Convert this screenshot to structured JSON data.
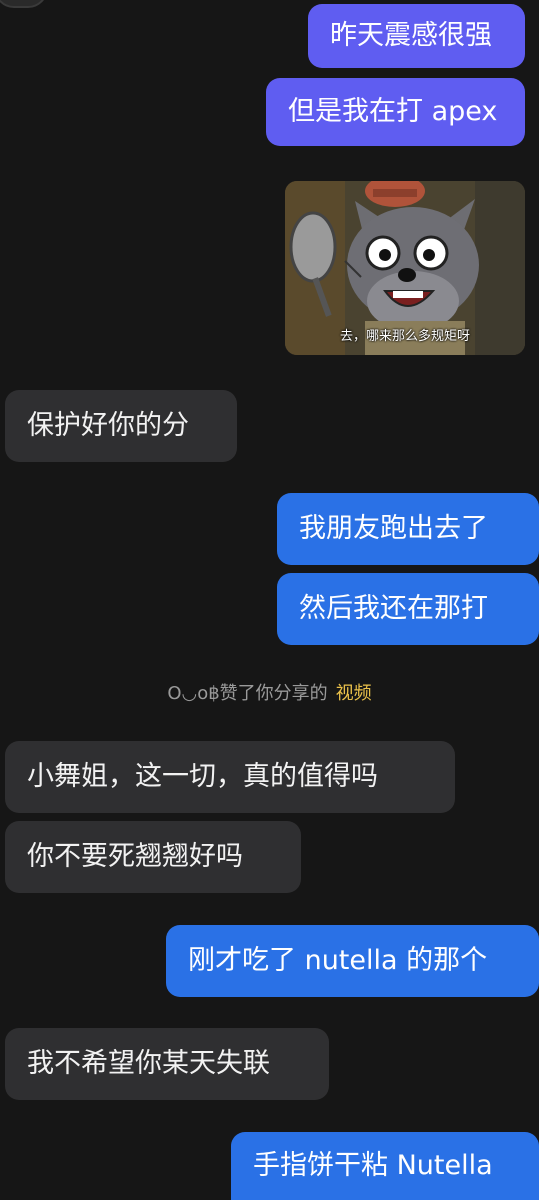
{
  "messages": [
    {
      "text": "昨天震感很强"
    },
    {
      "text": "但是我在打 apex"
    },
    {
      "caption": "去，哪来那么多规矩呀"
    },
    {
      "text": "保护好你的分"
    },
    {
      "text": "我朋友跑出去了"
    },
    {
      "text": "然后我还在那打"
    },
    {
      "text": "小舞姐，这一切，真的值得吗"
    },
    {
      "text": "你不要死翘翘好吗"
    },
    {
      "text": "刚才吃了 nutella 的那个"
    },
    {
      "text": "我不希望你某天失联"
    },
    {
      "text": "手指饼干粘 Nutella"
    }
  ],
  "system_note": {
    "text": "O◡o฿赞了你分享的",
    "link": "视频"
  },
  "colors": {
    "outgoing_purple": "#5f5df1",
    "outgoing_blue": "#2a71e6",
    "incoming": "#2f2f31",
    "background": "#161616",
    "link": "#e9c04a"
  }
}
